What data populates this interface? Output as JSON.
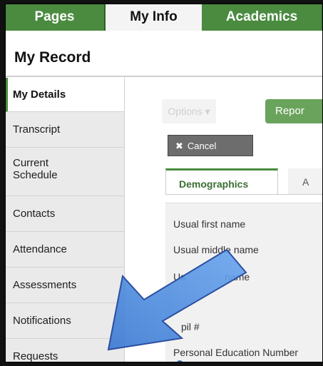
{
  "top_tabs": [
    {
      "label": "Pages",
      "active": false
    },
    {
      "label": "My Info",
      "active": true
    },
    {
      "label": "Academics",
      "active": false
    }
  ],
  "record_title": "My Record",
  "sidebar": {
    "items": [
      {
        "label": "My Details",
        "active": true
      },
      {
        "label": "Transcript",
        "active": false
      },
      {
        "label": "Current Schedule",
        "active": false
      },
      {
        "label": "Contacts",
        "active": false
      },
      {
        "label": "Attendance",
        "active": false
      },
      {
        "label": "Assessments",
        "active": false
      },
      {
        "label": "Notifications",
        "active": false
      },
      {
        "label": "Requests",
        "active": false
      }
    ]
  },
  "toolbar": {
    "options_label": "Options",
    "report_label": "Repor",
    "cancel_label": "Cancel"
  },
  "subtabs": [
    {
      "label": "Demographics",
      "active": true
    },
    {
      "label": "A",
      "active": false
    }
  ],
  "form": {
    "fields": [
      "Usual first name",
      "Usual middle name",
      "Usual last name",
      "Pupil #",
      "Personal Education Number"
    ],
    "visible_partial": {
      "last_name_prefix": "Us",
      "last_name_suffix": "name",
      "pupil": "pil #"
    }
  },
  "colors": {
    "green_dark": "#3d7a36",
    "green_tab": "#4a8b40",
    "arrow_blue": "#3f7ed6"
  }
}
